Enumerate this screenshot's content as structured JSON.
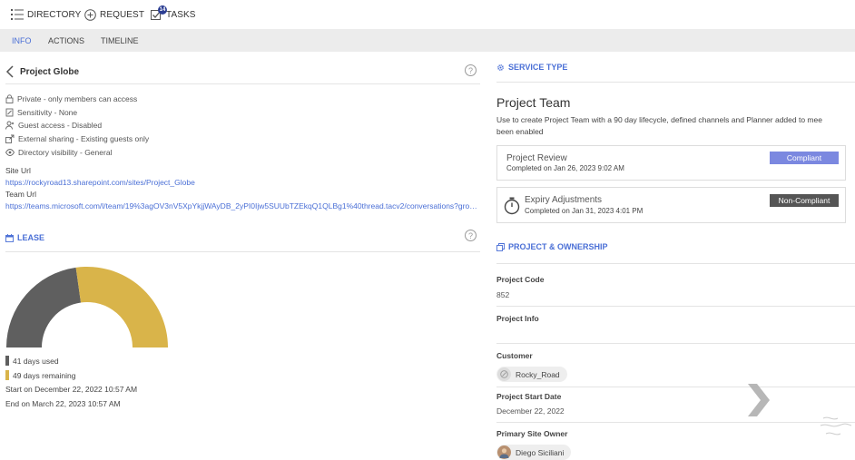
{
  "nav": {
    "directory": "DIRECTORY",
    "request": "REQUEST",
    "tasks": "TASKS",
    "tasks_badge": "14"
  },
  "tabs": [
    {
      "label": "INFO",
      "active": true
    },
    {
      "label": "ACTIONS",
      "active": false
    },
    {
      "label": "TIMELINE",
      "active": false
    }
  ],
  "project": {
    "title": "Project Globe",
    "properties": [
      {
        "icon": "lock-icon",
        "text": "Private - only members can access"
      },
      {
        "icon": "sensitivity-icon",
        "text": "Sensitivity - None"
      },
      {
        "icon": "guest-access-icon",
        "text": "Guest access - Disabled"
      },
      {
        "icon": "external-sharing-icon",
        "text": "External sharing - Existing guests only"
      },
      {
        "icon": "eye-icon",
        "text": "Directory visibility - General"
      }
    ],
    "site_url_label": "Site Url",
    "site_url": "https://rockyroad13.sharepoint.com/sites/Project_Globe",
    "team_url_label": "Team Url",
    "team_url": "https://teams.microsoft.com/l/team/19%3agOV3nV5XpYkjjWAyDB_2yPI0Ijw5SUUbTZEkqQ1QLBg1%40thread.tacv2/conversations?groupId=..."
  },
  "lease": {
    "title": "LEASE",
    "used_days": 41,
    "remaining_days": 49,
    "used_label": "41 days used",
    "remaining_label": "49 days remaining",
    "start_text": "Start on December 22, 2022 10:57 AM",
    "end_text": "End on March 22, 2023 10:57 AM",
    "used_color": "#5f5f5f",
    "remaining_color": "#d9b44a"
  },
  "service": {
    "section_title": "SERVICE TYPE",
    "name": "Project Team",
    "description_line1": "Use to create Project Team with a 90 day lifecycle, defined channels and Planner added to mee",
    "description_line2": "been enabled",
    "reviews": [
      {
        "title": "Project Review",
        "completed": "Completed on Jan 26, 2023 9:02 AM",
        "status": "Compliant",
        "status_color": "#7b88e0",
        "icon": ""
      },
      {
        "title": "Expiry Adjustments",
        "completed": "Completed on Jan 31, 2023 4:01 PM",
        "status": "Non-Compliant",
        "status_color": "#555555",
        "icon": "timer-icon"
      }
    ]
  },
  "ownership": {
    "section_title": "PROJECT & OWNERSHIP",
    "project_code_label": "Project Code",
    "project_code": "852",
    "project_info_label": "Project Info",
    "customer_label": "Customer",
    "customer": "Rocky_Road",
    "start_date_label": "Project Start Date",
    "start_date": "December 22, 2022",
    "owner_label": "Primary Site Owner",
    "owner": "Diego Siciliani"
  },
  "accent_color": "#4a6fd6"
}
